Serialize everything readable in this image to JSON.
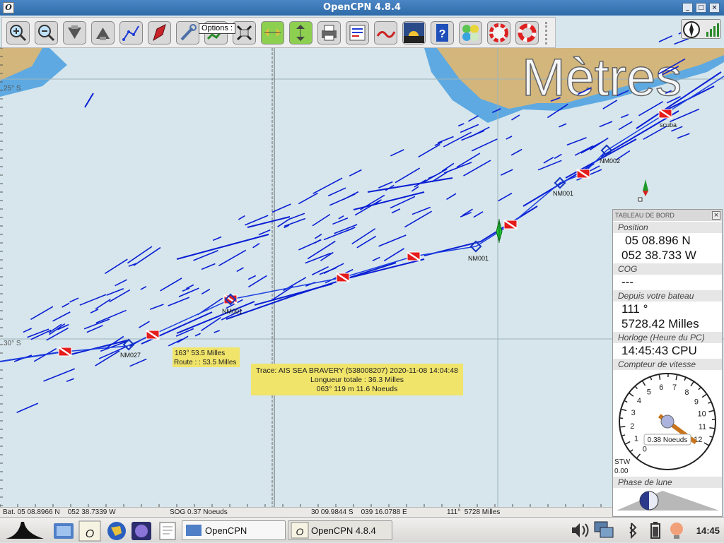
{
  "window": {
    "title": "OpenCPN 4.8.4",
    "buttons": [
      "_",
      "□",
      "×"
    ]
  },
  "toolbar": {
    "tooltip": "Options :",
    "buttons": [
      "zoom-in",
      "zoom-out",
      "scale-in",
      "scale-out",
      "route",
      "auto-follow",
      "settings",
      "tracking",
      "ais-toggle",
      "chart-quilt",
      "print",
      "route-manager",
      "tide-current",
      "color-scheme",
      "help",
      "layers",
      "dashboard",
      "man-overboard"
    ]
  },
  "chart": {
    "units_label": "Mètres",
    "lat_labels": [
      "25° S",
      "30° S"
    ],
    "waypoints": [
      "scuba",
      "NM002",
      "NM001",
      "NM001",
      "NM001",
      "NM027"
    ],
    "route_tip": {
      "line1": "163°  53.5 Milles",
      "line2": "Route : : 53.5 Milles"
    },
    "track_tip": {
      "line1": "Trace: AIS SEA BRAVERY (538008207) 2020-11-08 14:04:48",
      "line2": "Longueur totale : 36.3 Milles",
      "line3": "063°  119 m  11.6 Noeuds"
    },
    "colors": {
      "sea": "#d6e6ec",
      "land": "#d3b67c",
      "shallow": "#5ea9e1",
      "track": "#0a1ed4",
      "tip": "#f0e46a"
    }
  },
  "statusbar": {
    "boat": "Bat. 05 08.8966 N    052 38.7339 W",
    "sog": "SOG 0.37 Noeuds",
    "cursor": "30 09.9844 S    039 16.0788 E",
    "bearing": "111°  5728 Milles"
  },
  "dashboard": {
    "header": "TABLEAU DE BORD",
    "position_caption": "Position",
    "lat": "05 08.896 N",
    "lon": "052 38.733 W",
    "cog_caption": "COG",
    "cog_value": "---",
    "from_boat_caption": "Depuis votre bateau",
    "bearing": "111 °",
    "distance": "5728.42 Milles",
    "clock_caption": "Horloge (Heure du PC)",
    "clock_value": "14:45:43 CPU",
    "speedo_caption": "Compteur de vitesse",
    "speed_label": "0.38 Noeuds",
    "stw_label": "STW",
    "stw_value": "0.00",
    "moon_caption": "Phase de lune",
    "speedo_ticks": [
      "0",
      "1",
      "2",
      "3",
      "4",
      "5",
      "6",
      "7",
      "8",
      "9",
      "10",
      "11",
      "12"
    ],
    "speed_value": 0.38
  },
  "taskbar": {
    "windows": [
      "OpenCPN",
      "OpenCPN 4.8.4"
    ],
    "time": "14:45"
  }
}
